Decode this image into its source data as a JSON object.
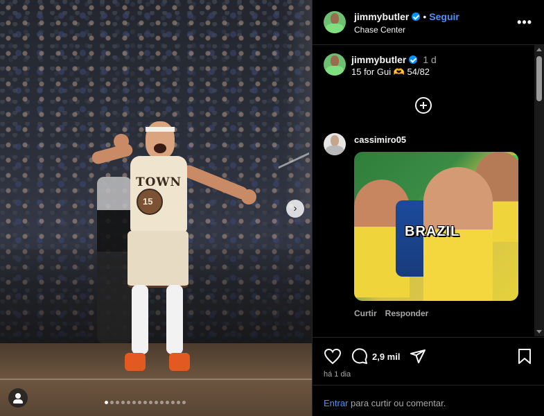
{
  "post": {
    "username": "jimmybutler",
    "follow_label": "Seguir",
    "separator": "•",
    "location": "Chase Center",
    "more_label": "•••",
    "caption": {
      "username": "jimmybutler",
      "time": "1 d",
      "text": "15 for Gui 🫶 54/82"
    }
  },
  "media": {
    "jersey_text": "TOWN",
    "jersey_number": "15",
    "next_label": "›",
    "carousel_dot_count": 15,
    "carousel_active_index": 0
  },
  "comment": {
    "username": "cassimiro05",
    "gif_text": "BRAZIL",
    "like_label": "Curtir",
    "reply_label": "Responder"
  },
  "actions": {
    "likes_count": "2,9 mil",
    "post_age": "há 1 dia"
  },
  "login": {
    "link_label": "Entrar",
    "rest_label": "para curtir ou comentar."
  },
  "colors": {
    "accent": "#4a93ff",
    "verified": "#0095f6",
    "background": "#000000",
    "muted_text": "#a8a8a8"
  }
}
